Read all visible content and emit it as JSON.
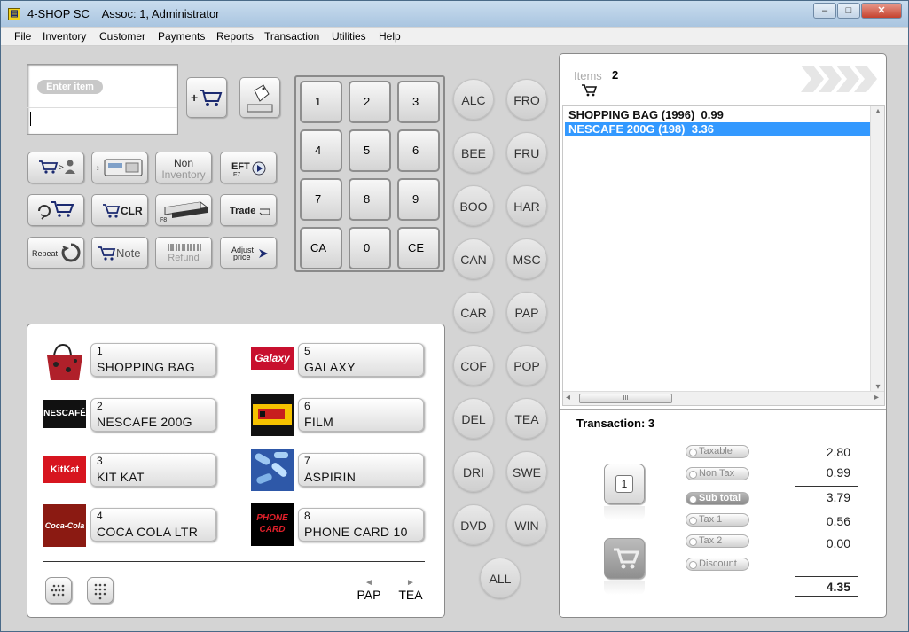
{
  "window": {
    "title": "4-SHOP SC    Assoc: 1, Administrator",
    "minimize": "–",
    "maximize": "□",
    "close": "✕"
  },
  "menu": [
    "File",
    "Inventory",
    "Customer",
    "Payments",
    "Reports",
    "Transaction",
    "Utilities",
    "Help"
  ],
  "entry": {
    "placeholder": "Enter item",
    "value": ""
  },
  "func_buttons": {
    "non_inventory_1": "Non",
    "non_inventory_2": "Inventory",
    "eft": "EFT",
    "eft_key": "F7",
    "clr": "CLR",
    "drawer_key": "F8",
    "trade": "Trade",
    "repeat": "Repeat",
    "note": "Note",
    "refund": "Refund",
    "adjust_1": "Adjust",
    "adjust_2": "price"
  },
  "keypad": [
    "1",
    "2",
    "3",
    "4",
    "5",
    "6",
    "7",
    "8",
    "9",
    "CA",
    "0",
    "CE"
  ],
  "categories_left": [
    "ALC",
    "BEE",
    "BOO",
    "CAN",
    "CAR",
    "COF",
    "DEL",
    "DRI",
    "DVD"
  ],
  "categories_right": [
    "FRO",
    "FRU",
    "HAR",
    "MSC",
    "PAP",
    "POP",
    "TEA",
    "SWE",
    "WIN"
  ],
  "category_all": "ALL",
  "products": [
    {
      "num": "1",
      "name": "SHOPPING BAG"
    },
    {
      "num": "5",
      "name": "GALAXY"
    },
    {
      "num": "2",
      "name": "NESCAFE 200G"
    },
    {
      "num": "6",
      "name": "FILM"
    },
    {
      "num": "3",
      "name": "KIT KAT"
    },
    {
      "num": "7",
      "name": "ASPIRIN"
    },
    {
      "num": "4",
      "name": "COCA COLA LTR"
    },
    {
      "num": "8",
      "name": "PHONE CARD 10"
    }
  ],
  "thumb_text": {
    "galaxy": "Galaxy",
    "nescafe": "NESCAFÉ",
    "kitkat": "KitKat",
    "coca": "Coca-Cola",
    "phone_1": "PHONE",
    "phone_2": "CARD"
  },
  "product_nav": {
    "prev": "PAP",
    "next": "TEA"
  },
  "items": {
    "label": "Items",
    "count": "2"
  },
  "list": [
    {
      "text": "SHOPPING BAG (1996)  0.99",
      "selected": false
    },
    {
      "text": "NESCAFE 200G (198)  3.36",
      "selected": true
    }
  ],
  "scroll": {
    "grip": "III",
    "left": "◂",
    "right": "▸",
    "up": "▴",
    "down": "▾"
  },
  "transaction": {
    "label": "Transaction: 3",
    "customer_count": "1"
  },
  "totals": [
    {
      "label": "Taxable",
      "value": "2.80",
      "active": false
    },
    {
      "label": "Non Tax",
      "value": "0.99",
      "active": false
    },
    {
      "label": "Sub total",
      "value": "3.79",
      "active": true
    },
    {
      "label": "Tax 1",
      "value": "0.56",
      "active": false
    },
    {
      "label": "Tax 2",
      "value": "0.00",
      "active": false
    },
    {
      "label": "Discount",
      "value": "",
      "active": false
    }
  ],
  "grand_total": "4.35",
  "colors": {
    "selection": "#3399ff",
    "accent_blue": "#1b2a70",
    "panel_bg": "#d4d4d4"
  }
}
